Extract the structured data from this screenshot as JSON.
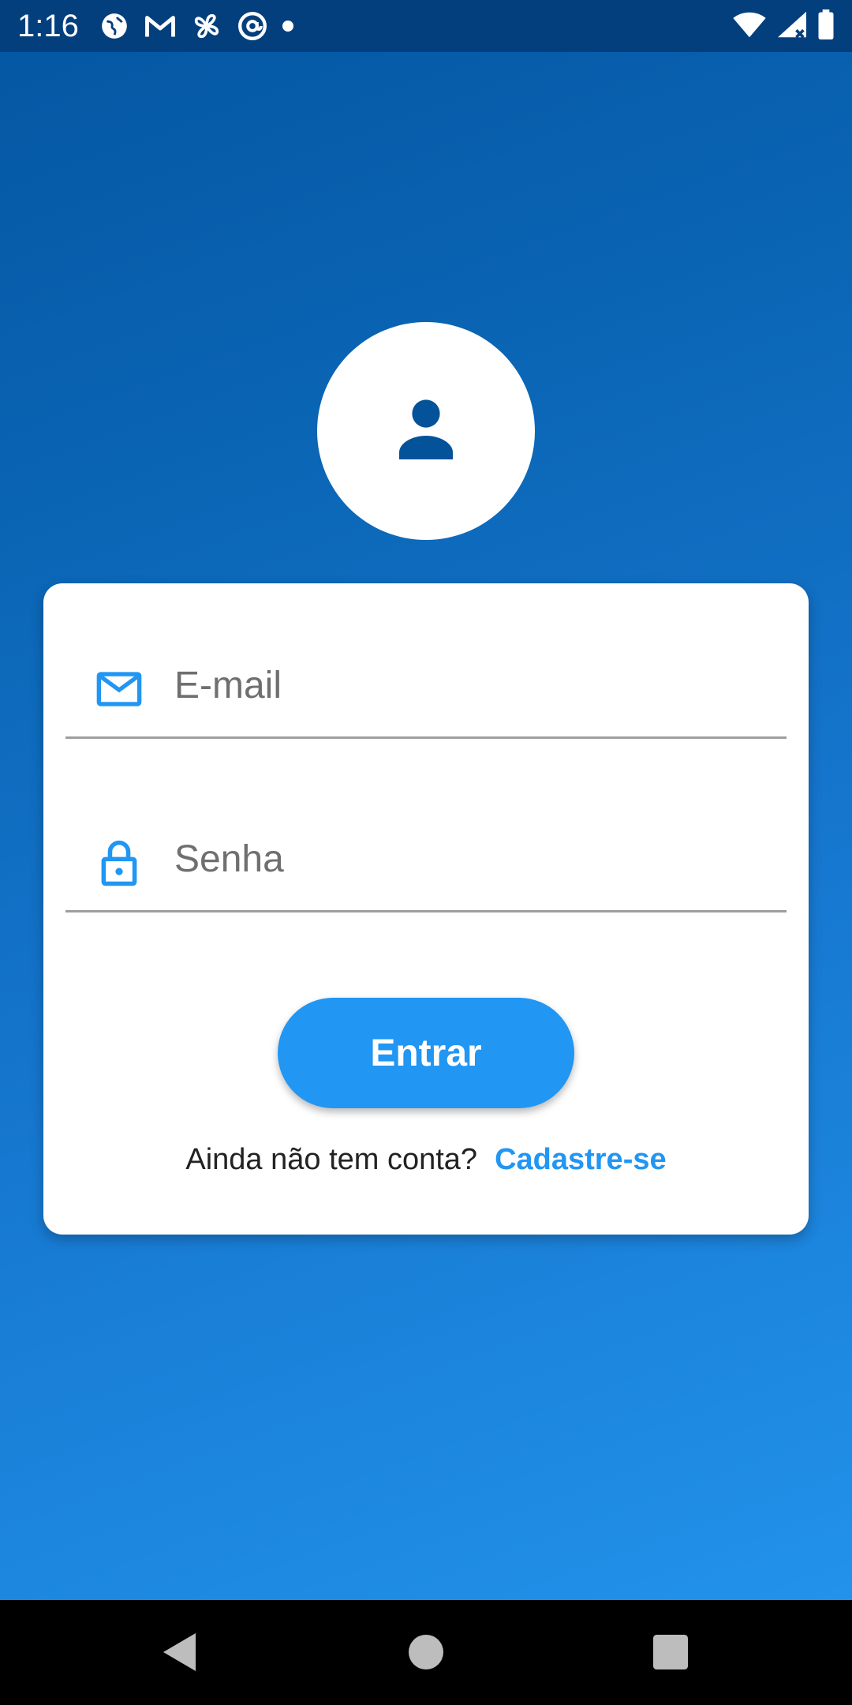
{
  "status_bar": {
    "time": "1:16",
    "left_icons": [
      "vpn-globe-icon",
      "gmail-icon",
      "pinwheel-icon",
      "at-sign-icon",
      "notification-dot-icon"
    ],
    "right_icons": [
      "wifi-icon",
      "cell-signal-icon",
      "battery-icon"
    ]
  },
  "avatar": {
    "icon": "person-icon"
  },
  "login_form": {
    "email": {
      "placeholder": "E-mail",
      "value": "",
      "icon": "mail-icon"
    },
    "password": {
      "placeholder": "Senha",
      "value": "",
      "icon": "lock-icon"
    },
    "submit_label": "Entrar",
    "signup_prompt": "Ainda não tem conta?",
    "signup_link": "Cadastre-se"
  },
  "nav_bar": {
    "buttons": [
      "back-icon",
      "home-icon",
      "recents-icon"
    ]
  },
  "colors": {
    "accent": "#2196f3",
    "status_bar": "#043f7d",
    "avatar_icon": "#045299",
    "gradient_start": "#0456a1",
    "gradient_end": "#2292ea"
  }
}
